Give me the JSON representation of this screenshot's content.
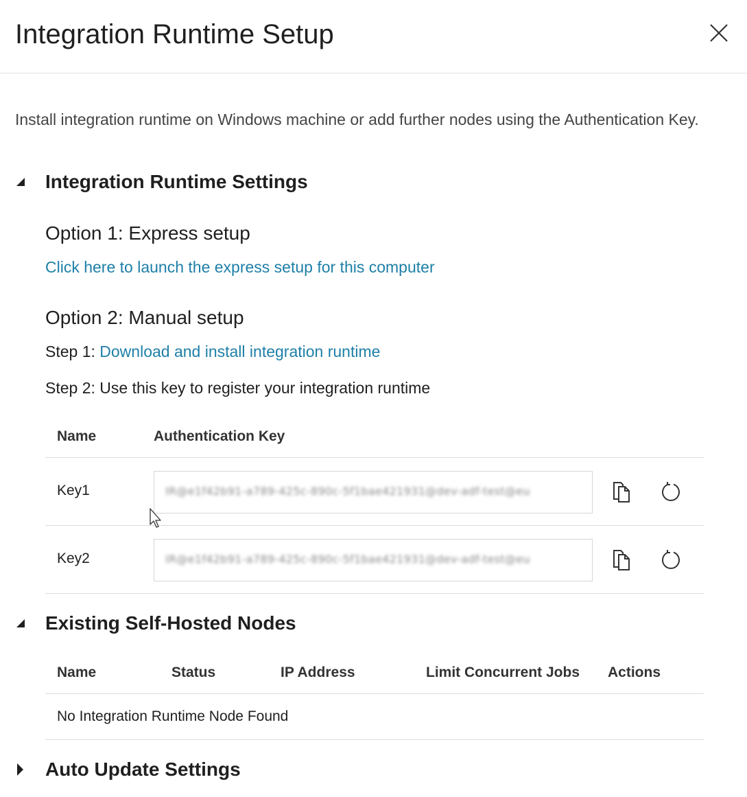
{
  "dialog": {
    "title": "Integration Runtime Setup",
    "description": "Install integration runtime on Windows machine or add further nodes using the Authentication Key."
  },
  "settings_section": {
    "title": "Integration Runtime Settings",
    "expanded": true,
    "option1": {
      "title": "Option 1: Express setup",
      "link": "Click here to launch the express setup for this computer"
    },
    "option2": {
      "title": "Option 2: Manual setup",
      "step1_prefix": "Step 1: ",
      "step1_link": "Download and install integration runtime",
      "step2": "Step 2: Use this key to register your integration runtime"
    },
    "keys_table": {
      "columns": [
        "Name",
        "Authentication Key"
      ],
      "rows": [
        {
          "name": "Key1",
          "value": "IR@e1f42b91-a789-425c-890c-5f1bae421931@dev-adf-test@eu"
        },
        {
          "name": "Key2",
          "value": "IR@e1f42b91-a789-425c-890c-5f1bae421931@dev-adf-test@eu"
        }
      ]
    }
  },
  "nodes_section": {
    "title": "Existing Self-Hosted Nodes",
    "expanded": true,
    "columns": [
      "Name",
      "Status",
      "IP Address",
      "Limit Concurrent Jobs",
      "Actions"
    ],
    "empty_message": "No Integration Runtime Node Found"
  },
  "update_section": {
    "title": "Auto Update Settings",
    "expanded": false
  },
  "icons": {
    "close": "close-icon",
    "expanded": "caret-down-icon",
    "collapsed": "caret-right-icon",
    "copy": "copy-icon",
    "refresh": "refresh-icon"
  },
  "colors": {
    "link": "#1e7fa7",
    "text": "#1f1f1f",
    "divider": "#dcdcdc"
  }
}
